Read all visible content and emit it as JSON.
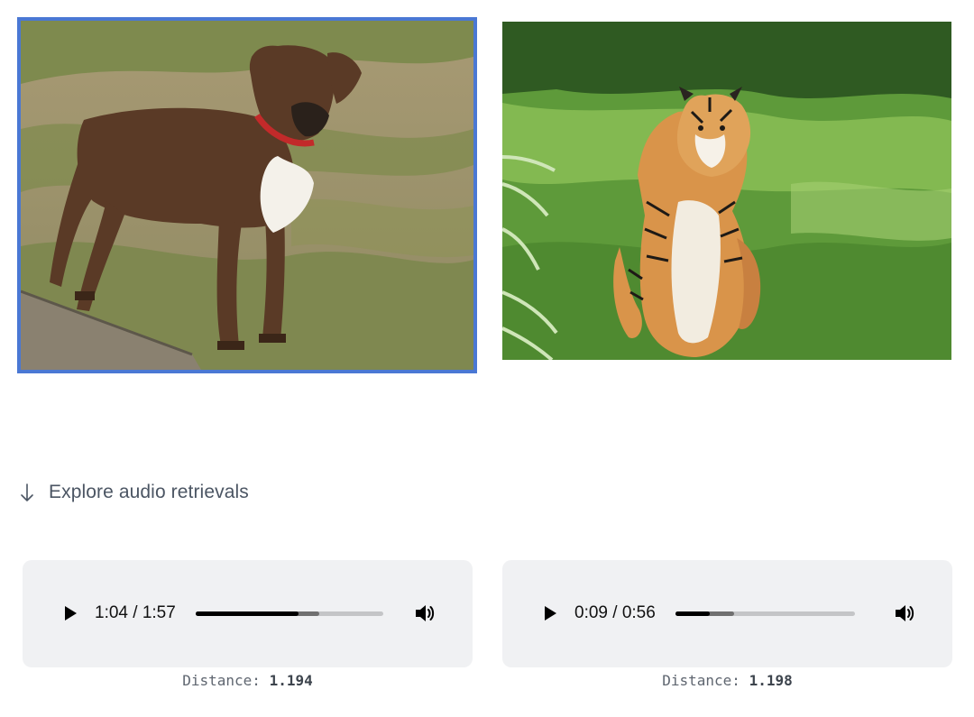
{
  "images": [
    {
      "subject": "boxer dog standing on grass",
      "selected": true
    },
    {
      "subject": "tiger sitting on grass",
      "selected": false
    }
  ],
  "explore": {
    "label": "Explore audio retrievals",
    "icon": "arrow-down-icon"
  },
  "audio_results": [
    {
      "time": "1:04 / 1:57",
      "progress": 0.55,
      "buffered": 0.66,
      "distance_label": "Distance:",
      "distance_value": "1.194"
    },
    {
      "time": "0:09 / 0:56",
      "progress": 0.19,
      "buffered": 0.33,
      "distance_label": "Distance:",
      "distance_value": "1.198"
    }
  ],
  "colors": {
    "selected_border": "#4a78d4",
    "panel_bg": "#f0f1f3"
  }
}
